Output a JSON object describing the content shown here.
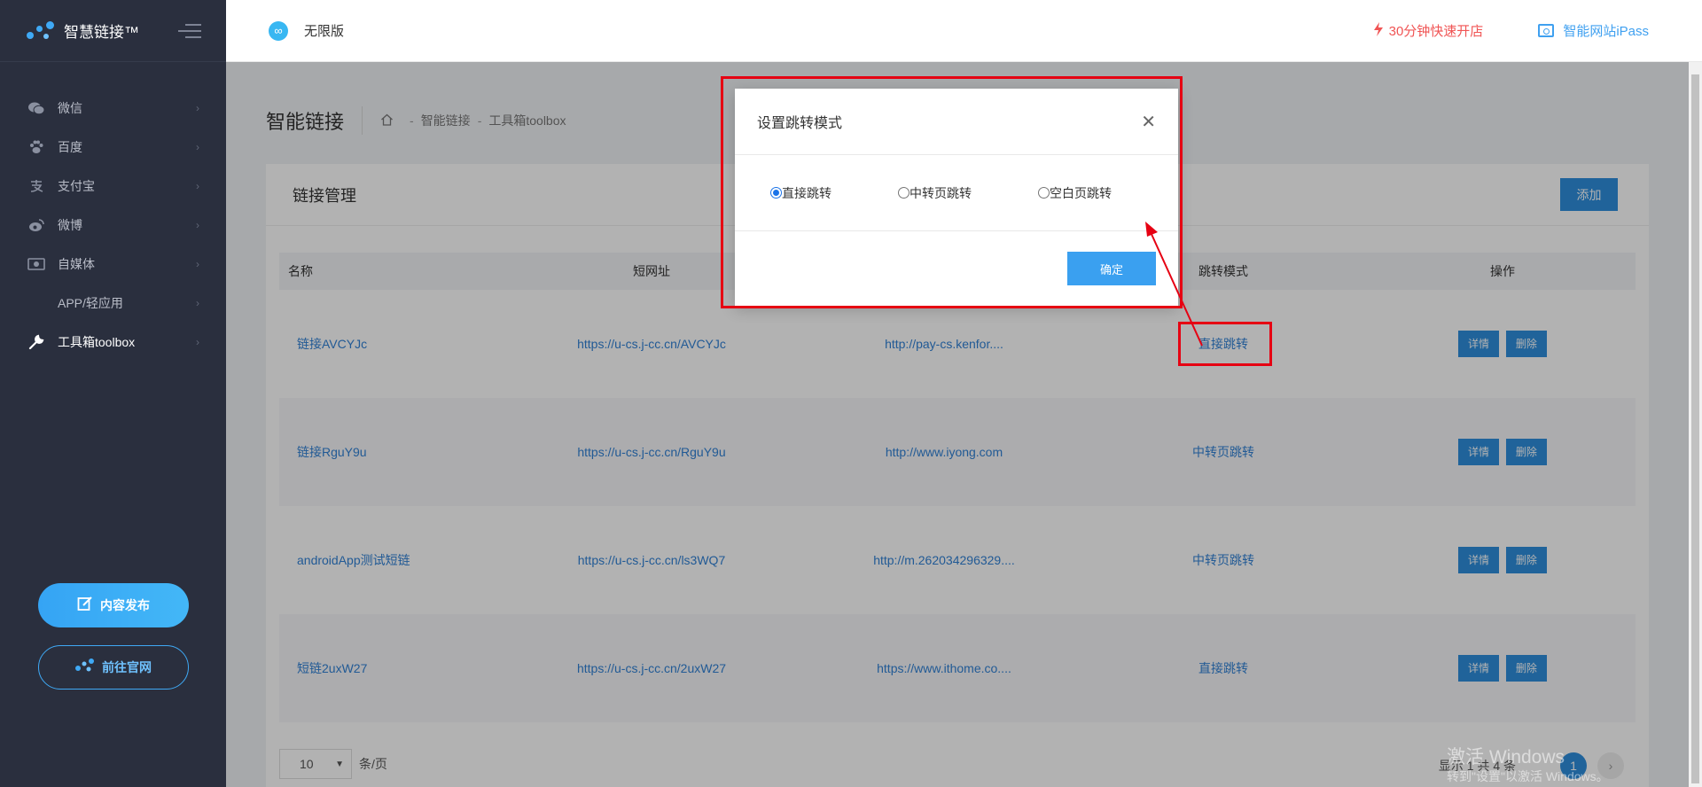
{
  "sidebar": {
    "logo_title": "智慧链接™",
    "menu": [
      {
        "label": "微信",
        "icon": "wechat-icon"
      },
      {
        "label": "百度",
        "icon": "baidu-paw-icon"
      },
      {
        "label": "支付宝",
        "icon": "alipay-icon"
      },
      {
        "label": "微博",
        "icon": "weibo-icon"
      },
      {
        "label": "自媒体",
        "icon": "media-icon"
      },
      {
        "label": "APP/轻应用",
        "icon": "app-icon"
      },
      {
        "label": "工具箱toolbox",
        "icon": "wrench-icon",
        "active": true
      }
    ],
    "publish_button": "内容发布",
    "website_button": "前往官网"
  },
  "topbar": {
    "edition": "无限版",
    "promo": "30分钟快速开店",
    "ipass": "智能网站iPass"
  },
  "page": {
    "title": "智能链接",
    "breadcrumb": [
      "智能链接",
      "工具箱toolbox"
    ]
  },
  "card": {
    "title": "链接管理",
    "add_button": "添加"
  },
  "table": {
    "headers": [
      "名称",
      "短网址",
      "",
      "跳转模式",
      "操作"
    ],
    "rows": [
      {
        "name": "链接AVCYJc",
        "short": "https://u-cs.j-cc.cn/AVCYJc",
        "target": "http://pay-cs.kenfor....",
        "mode": "直接跳转"
      },
      {
        "name": "链接RguY9u",
        "short": "https://u-cs.j-cc.cn/RguY9u",
        "target": "http://www.iyong.com",
        "mode": "中转页跳转"
      },
      {
        "name": "androidApp测试短链",
        "short": "https://u-cs.j-cc.cn/ls3WQ7",
        "target": "http://m.262034296329....",
        "mode": "中转页跳转"
      },
      {
        "name": "短链2uxW27",
        "short": "https://u-cs.j-cc.cn/2uxW27",
        "target": "https://www.ithome.co....",
        "mode": "直接跳转"
      }
    ],
    "detail_button": "详情",
    "delete_button": "删除"
  },
  "pagination": {
    "page_size": "10",
    "per_page_label": "条/页",
    "summary": "显示 1 共 4 条",
    "current_page": "1"
  },
  "modal": {
    "title": "设置跳转模式",
    "options": [
      "直接跳转",
      "中转页跳转",
      "空白页跳转"
    ],
    "selected": "直接跳转",
    "ok_button": "确定"
  },
  "watermark": {
    "line1": "激活 Windows",
    "line2": "转到\"设置\"以激活 Windows。"
  },
  "colors": {
    "sidebar_bg": "#2a2f3e",
    "accent": "#2f8fdd",
    "annotation": "#e60012",
    "promo": "#f05454"
  }
}
